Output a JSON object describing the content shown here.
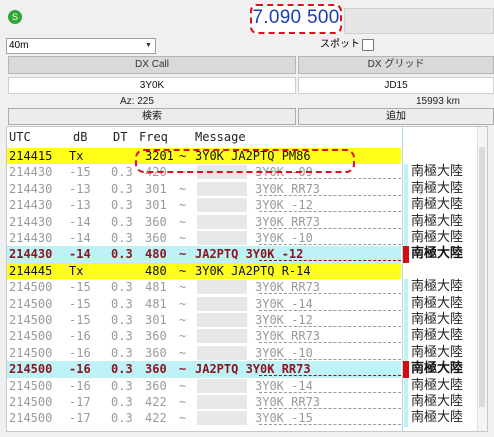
{
  "top": {
    "status_icon_glyph": "S",
    "status_color": "#2fa836",
    "dial_frequency": "7.090 500",
    "frequency_color": "#1c3fb0"
  },
  "band": {
    "selected": "40m"
  },
  "spot": {
    "label": "スポット",
    "checked": false
  },
  "dx": {
    "call_header": "DX Call",
    "grid_header": "DX グリッド",
    "call_value": "3Y0K",
    "grid_value": "JD15",
    "azimuth": "Az: 225",
    "distance": "15993 km",
    "lookup_button": "検索",
    "add_button": "追加"
  },
  "decode_table": {
    "columns": [
      "UTC",
      "dB",
      "DT",
      "Freq",
      "Message"
    ],
    "rows": [
      {
        "type": "tx",
        "utc": "214415",
        "db": "Tx",
        "dt": "",
        "freq": "3201",
        "sep": "~",
        "msg": "3Y0K JA2PTQ PM86",
        "country": ""
      },
      {
        "type": "cq",
        "utc": "214430",
        "db": "-15",
        "dt": "0.3",
        "freq": "420",
        "sep": "~",
        "msg": "3Y0K -09",
        "country": "南極大陸"
      },
      {
        "type": "cq",
        "utc": "214430",
        "db": "-13",
        "dt": "0.3",
        "freq": "301",
        "sep": "~",
        "msg": "3Y0K RR73",
        "country": "南極大陸"
      },
      {
        "type": "cq",
        "utc": "214430",
        "db": "-13",
        "dt": "0.3",
        "freq": "301",
        "sep": "~",
        "msg": "3Y0K -12",
        "country": "南極大陸"
      },
      {
        "type": "cq",
        "utc": "214430",
        "db": "-14",
        "dt": "0.3",
        "freq": "360",
        "sep": "~",
        "msg": "3Y0K RR73",
        "country": "南極大陸"
      },
      {
        "type": "cq",
        "utc": "214430",
        "db": "-14",
        "dt": "0.3",
        "freq": "360",
        "sep": "~",
        "msg": "3Y0K -10",
        "country": "南極大陸"
      },
      {
        "type": "red",
        "utc": "214430",
        "db": "-14",
        "dt": "0.3",
        "freq": "480",
        "sep": "~",
        "msg": "JA2PTQ 3Y0K -12",
        "country": "南極大陸"
      },
      {
        "type": "tx",
        "utc": "214445",
        "db": "Tx",
        "dt": "",
        "freq": "480",
        "sep": "~",
        "msg": "3Y0K JA2PTQ R-14",
        "country": ""
      },
      {
        "type": "cq",
        "utc": "214500",
        "db": "-15",
        "dt": "0.3",
        "freq": "481",
        "sep": "~",
        "msg": "3Y0K RR73",
        "country": "南極大陸"
      },
      {
        "type": "cq",
        "utc": "214500",
        "db": "-15",
        "dt": "0.3",
        "freq": "481",
        "sep": "~",
        "msg": "3Y0K -14",
        "country": "南極大陸"
      },
      {
        "type": "cq",
        "utc": "214500",
        "db": "-15",
        "dt": "0.3",
        "freq": "301",
        "sep": "~",
        "msg": "3Y0K -12",
        "country": "南極大陸"
      },
      {
        "type": "cq",
        "utc": "214500",
        "db": "-16",
        "dt": "0.3",
        "freq": "360",
        "sep": "~",
        "msg": "3Y0K RR73",
        "country": "南極大陸"
      },
      {
        "type": "cq",
        "utc": "214500",
        "db": "-16",
        "dt": "0.3",
        "freq": "360",
        "sep": "~",
        "msg": "3Y0K -10",
        "country": "南極大陸"
      },
      {
        "type": "red",
        "utc": "214500",
        "db": "-16",
        "dt": "0.3",
        "freq": "360",
        "sep": "~",
        "msg": "JA2PTQ 3Y0K RR73",
        "country": "南極大陸"
      },
      {
        "type": "cq",
        "utc": "214500",
        "db": "-16",
        "dt": "0.3",
        "freq": "360",
        "sep": "~",
        "msg": "3Y0K -14",
        "country": "南極大陸"
      },
      {
        "type": "cq",
        "utc": "214500",
        "db": "-17",
        "dt": "0.3",
        "freq": "422",
        "sep": "~",
        "msg": "3Y0K RR73",
        "country": "南極大陸"
      },
      {
        "type": "cq",
        "utc": "214500",
        "db": "-17",
        "dt": "0.3",
        "freq": "422",
        "sep": "~",
        "msg": "3Y0K -15",
        "country": "南極大陸"
      }
    ]
  }
}
